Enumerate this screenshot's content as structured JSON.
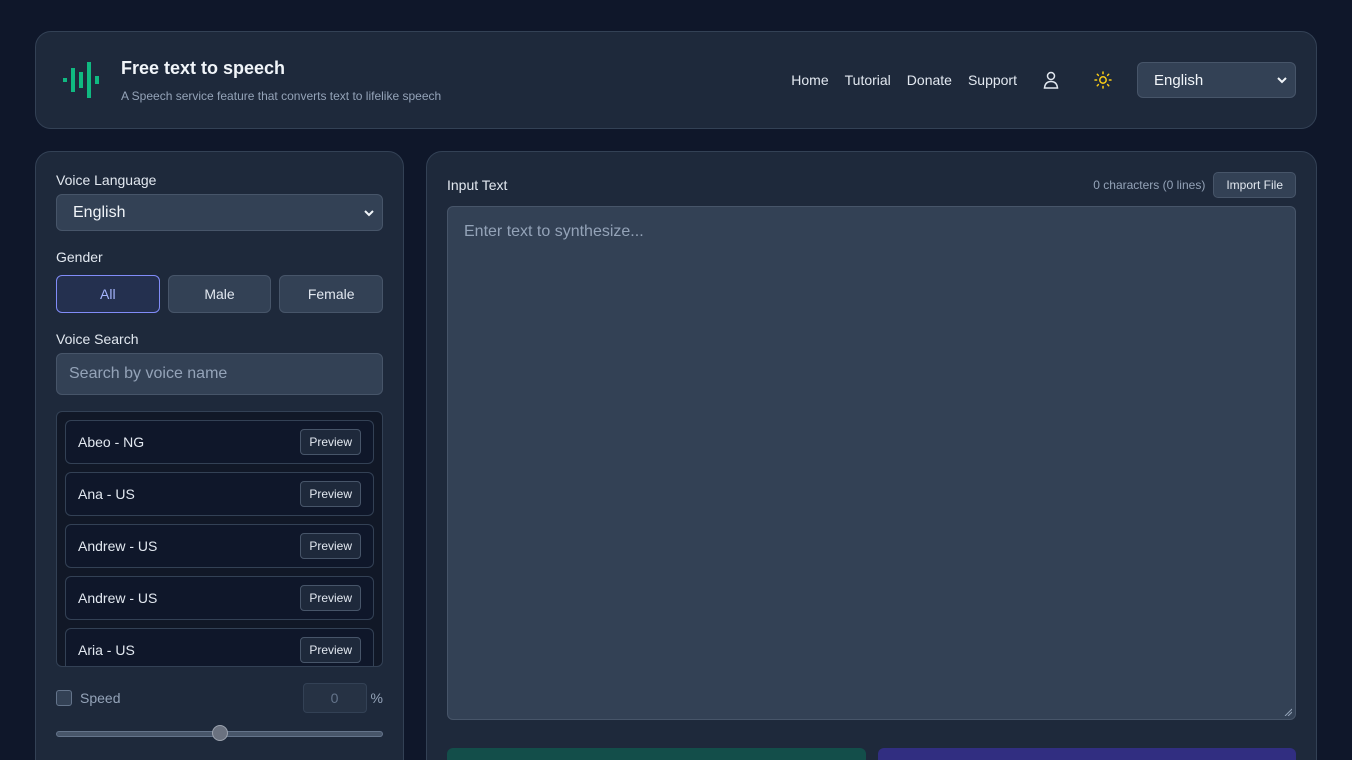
{
  "header": {
    "title": "Free text to speech",
    "subtitle": "A Speech service feature that converts text to lifelike speech",
    "nav": [
      "Home",
      "Tutorial",
      "Donate",
      "Support"
    ],
    "language_selected": "English",
    "icons": {
      "logo": "soundwave-icon",
      "account": "user-icon",
      "theme": "sun-icon"
    },
    "colors": {
      "logo": "#10b981",
      "sun": "#facc15"
    }
  },
  "left": {
    "voice_language_label": "Voice Language",
    "voice_language_selected": "English",
    "gender_label": "Gender",
    "gender_options": [
      "All",
      "Male",
      "Female"
    ],
    "gender_selected": "All",
    "voice_search_label": "Voice Search",
    "voice_search_placeholder": "Search by voice name",
    "preview_label": "Preview",
    "voices": [
      "Abeo - NG",
      "Ana - US",
      "Andrew - US",
      "Andrew - US",
      "Aria - US"
    ],
    "speed": {
      "label": "Speed",
      "value": "0",
      "unit": "%",
      "enabled": false,
      "slider_fraction": 0.5
    }
  },
  "right": {
    "input_label": "Input Text",
    "char_count": "0 characters (0 lines)",
    "import_label": "Import File",
    "textarea_placeholder": "Enter text to synthesize..."
  }
}
